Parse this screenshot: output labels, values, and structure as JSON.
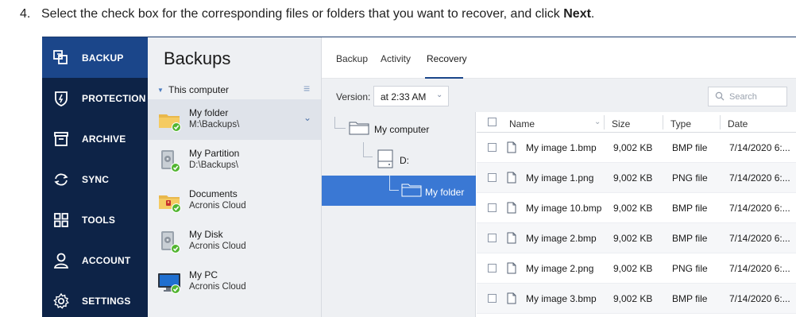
{
  "instruction": {
    "number": "4.",
    "text_before": "Select the check box for the corresponding files or folders that you want to recover, and click ",
    "bold": "Next",
    "text_after": "."
  },
  "nav": {
    "items": [
      {
        "label": "BACKUP",
        "icon": "backup-icon"
      },
      {
        "label": "PROTECTION",
        "icon": "shield-icon"
      },
      {
        "label": "ARCHIVE",
        "icon": "archive-icon"
      },
      {
        "label": "SYNC",
        "icon": "sync-icon"
      },
      {
        "label": "TOOLS",
        "icon": "tools-grid-icon"
      },
      {
        "label": "ACCOUNT",
        "icon": "account-icon"
      },
      {
        "label": "SETTINGS",
        "icon": "gear-icon"
      }
    ]
  },
  "backups": {
    "title": "Backups",
    "group": "This computer",
    "items": [
      {
        "name": "My folder",
        "location": "M:\\Backups\\",
        "icon": "folder-icon"
      },
      {
        "name": "My Partition",
        "location": "D:\\Backups\\",
        "icon": "disk-icon"
      },
      {
        "name": "Documents",
        "location": "Acronis Cloud",
        "icon": "folder-icon"
      },
      {
        "name": "My Disk",
        "location": "Acronis Cloud",
        "icon": "disk-icon"
      },
      {
        "name": "My PC",
        "location": "Acronis Cloud",
        "icon": "pc-icon"
      }
    ]
  },
  "tabs": [
    "Backup",
    "Activity",
    "Recovery"
  ],
  "toolbar": {
    "version_label": "Version:",
    "version_value": "at 2:33 AM",
    "search_placeholder": "Search"
  },
  "tree": {
    "nodes": [
      "My computer",
      "D:",
      "My folder"
    ]
  },
  "files": {
    "columns": [
      "Name",
      "Size",
      "Type",
      "Date"
    ],
    "rows": [
      {
        "name": "My image 1.bmp",
        "size": "9,002 KB",
        "type": "BMP file",
        "date": "7/14/2020 6:..."
      },
      {
        "name": "My image 1.png",
        "size": "9,002 KB",
        "type": "PNG file",
        "date": "7/14/2020 6:..."
      },
      {
        "name": "My image 10.bmp",
        "size": "9,002 KB",
        "type": "BMP file",
        "date": "7/14/2020 6:..."
      },
      {
        "name": "My image 2.bmp",
        "size": "9,002 KB",
        "type": "BMP file",
        "date": "7/14/2020 6:..."
      },
      {
        "name": "My image 2.png",
        "size": "9,002 KB",
        "type": "PNG file",
        "date": "7/14/2020 6:..."
      },
      {
        "name": "My image 3.bmp",
        "size": "9,002 KB",
        "type": "BMP file",
        "date": "7/14/2020 6:..."
      }
    ]
  },
  "colors": {
    "nav_bg": "#0d2347",
    "nav_active": "#1b468a",
    "selection": "#3a78d4",
    "status_ok": "#52b531"
  }
}
